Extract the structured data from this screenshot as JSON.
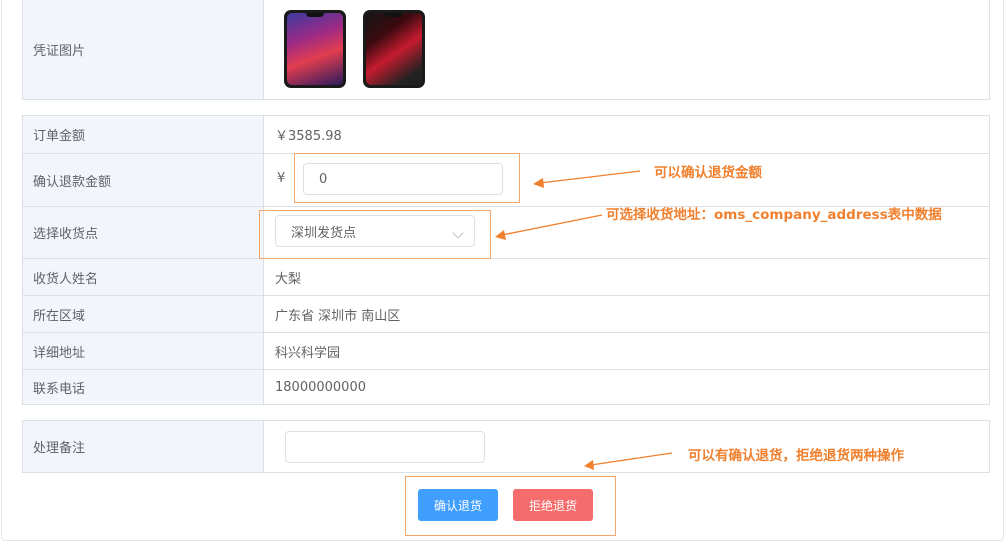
{
  "proof": {
    "label": "凭证图片",
    "images": [
      "phone-image-huawei",
      "phone-image-xiaomi"
    ]
  },
  "details": [
    {
      "label": "订单金额",
      "value": "￥3585.98"
    },
    {
      "label": "确认退款金额",
      "currency": "¥",
      "input_value": "0"
    },
    {
      "label": "选择收货点",
      "selected": "深圳发货点"
    },
    {
      "label": "收货人姓名",
      "value": "大梨"
    },
    {
      "label": "所在区域",
      "value": "广东省 深圳市 南山区"
    },
    {
      "label": "详细地址",
      "value": "科兴科学园"
    },
    {
      "label": "联系电话",
      "value": "18000000000"
    }
  ],
  "remark": {
    "label": "处理备注",
    "value": ""
  },
  "actions": {
    "confirm": "确认退货",
    "reject": "拒绝退货"
  },
  "annotations": {
    "refund": "可以确认退货金额",
    "address": "可选择收货地址：oms_company_address表中数据",
    "actions": "可以有确认退货，拒绝退货两种操作"
  },
  "colors": {
    "annotation": "#f0802e",
    "primary": "#409eff",
    "danger": "#f56c6c"
  }
}
